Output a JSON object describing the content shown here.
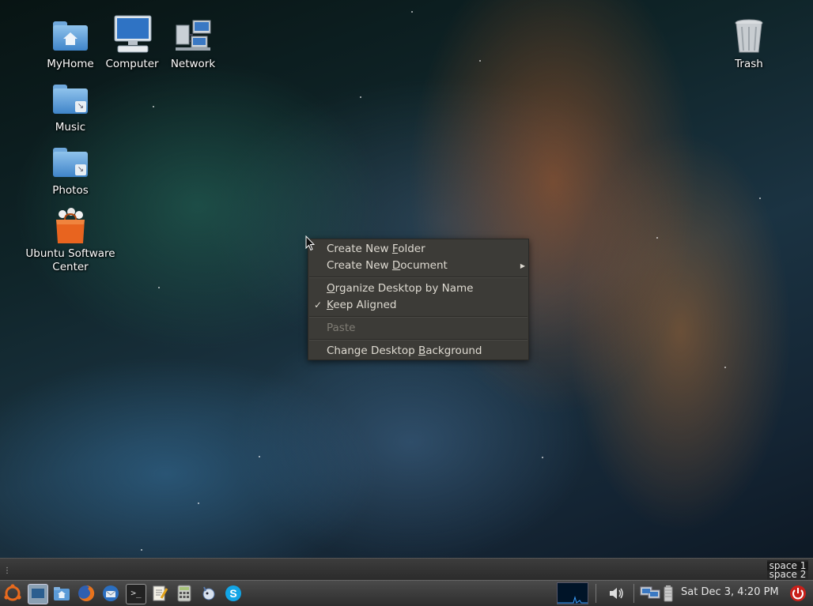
{
  "desktop": {
    "icons": [
      {
        "label": "MyHome"
      },
      {
        "label": "Computer"
      },
      {
        "label": "Network"
      },
      {
        "label": "Music"
      },
      {
        "label": "Photos"
      },
      {
        "label": "Ubuntu Software Center"
      },
      {
        "label": "Trash"
      }
    ]
  },
  "context_menu": {
    "items": [
      {
        "pre": "Create New ",
        "mn": "F",
        "post": "older",
        "has_submenu": false,
        "checked": false,
        "disabled": false
      },
      {
        "pre": "Create New ",
        "mn": "D",
        "post": "ocument",
        "has_submenu": true,
        "checked": false,
        "disabled": false
      },
      {
        "pre": "",
        "mn": "O",
        "post": "rganize Desktop by Name",
        "has_submenu": false,
        "checked": false,
        "disabled": false
      },
      {
        "pre": "",
        "mn": "K",
        "post": "eep Aligned",
        "has_submenu": false,
        "checked": true,
        "disabled": false
      },
      {
        "pre": "Paste",
        "mn": "",
        "post": "",
        "has_submenu": false,
        "checked": false,
        "disabled": true
      },
      {
        "pre": "Change Desktop ",
        "mn": "B",
        "post": "ackground",
        "has_submenu": false,
        "checked": false,
        "disabled": false
      }
    ],
    "checkmark": "✓",
    "submenu_arrow": "▶"
  },
  "panel": {
    "workspaces": [
      "space 1",
      "space 2"
    ],
    "clock": "Sat Dec  3,  4:20 PM",
    "launchers": [
      "ubuntu-logo",
      "show-desktop",
      "home-folder",
      "firefox",
      "thunderbird",
      "terminal",
      "text-editor",
      "calculator",
      "pidgin",
      "skype"
    ],
    "tray": [
      "system-monitor-graph",
      "volume",
      "network",
      "battery",
      "power"
    ]
  },
  "colors": {
    "menu_bg": "#3c3b37",
    "menu_text": "#dfdbd2",
    "menu_disabled": "#7f7c74",
    "panel_bg": "#3a3a3a",
    "power_red": "#d9231b"
  }
}
